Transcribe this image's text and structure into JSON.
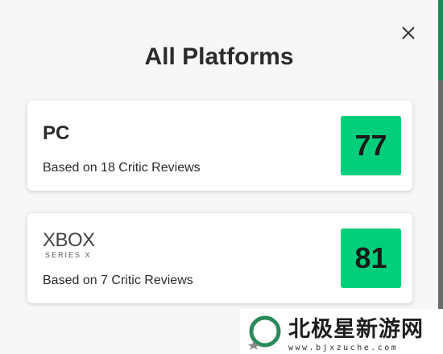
{
  "dialog": {
    "title": "All Platforms",
    "close_icon": "close-icon"
  },
  "platforms": [
    {
      "name": "PC",
      "reviews_text": "Based on 18 Critic Reviews",
      "score": "77",
      "score_color": "#00ce7a"
    },
    {
      "name": "XBOX",
      "name_sub": "SERIES X",
      "reviews_text": "Based on 7 Critic Reviews",
      "score": "81",
      "score_color": "#00ce7a"
    }
  ],
  "watermark": {
    "text": "北极星新游网",
    "url": "www.bjxzuche.com"
  }
}
